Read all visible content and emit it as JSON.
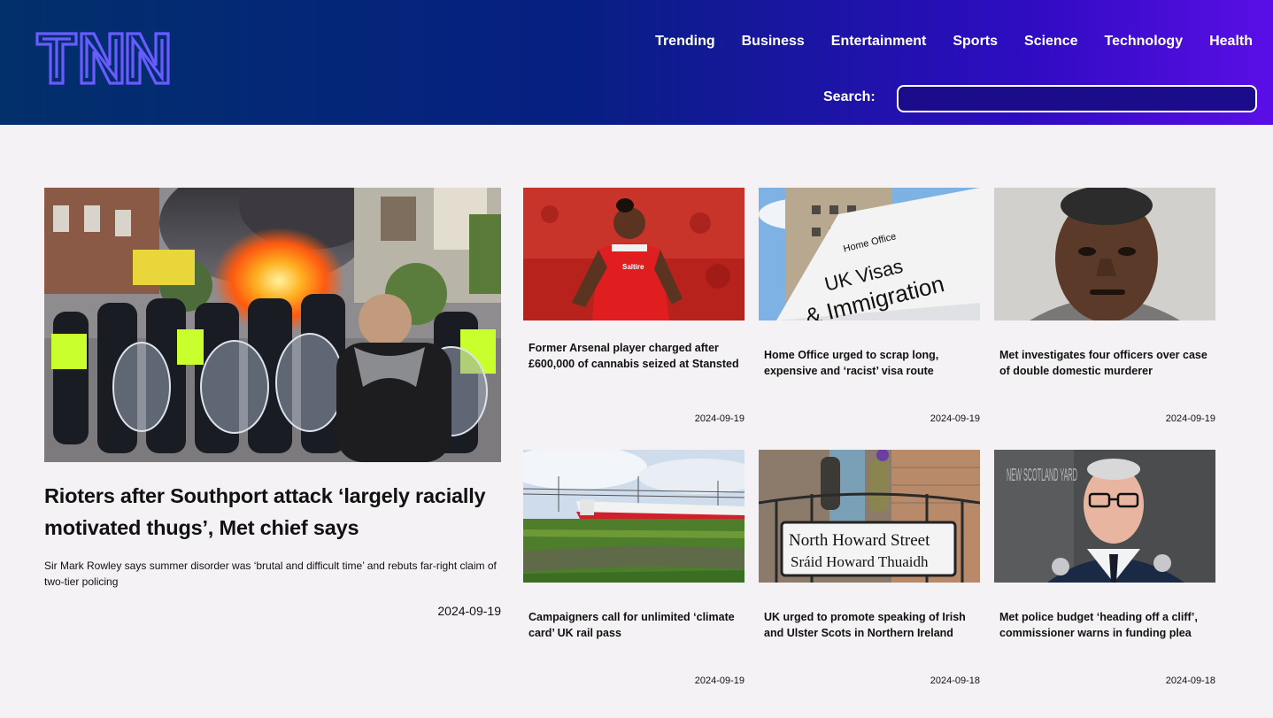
{
  "header": {
    "logo_text": "TNN",
    "nav": [
      "Trending",
      "Business",
      "Entertainment",
      "Sports",
      "Science",
      "Technology",
      "Health"
    ],
    "search_label": "Search:",
    "search_value": "",
    "search_placeholder": ""
  },
  "colors": {
    "accent_logo": "#6a5bff",
    "header_start": "#02306b",
    "header_end": "#5a0ee6"
  },
  "feature": {
    "title": "Rioters after Southport attack ‘largely racially motivated thugs’, Met chief says",
    "summary": "Sir Mark Rowley says summer disorder was ‘brutal and difficult time’ and rebuts far-right claim of two-tier policing",
    "date": "2024-09-19"
  },
  "cards": [
    {
      "title": "Former Arsenal player charged after £600,000 of cannabis seized at Stansted",
      "date": "2024-09-19"
    },
    {
      "title": "Home Office urged to scrap long, expensive and ‘racist’ visa route",
      "date": "2024-09-19"
    },
    {
      "title": "Met investigates four officers over case of double domestic murderer",
      "date": "2024-09-19"
    },
    {
      "title": "Campaigners call for unlimited ‘climate card’ UK rail pass",
      "date": "2024-09-19"
    },
    {
      "title": "UK urged to promote speaking of Irish and Ulster Scots in Northern Ireland",
      "date": "2024-09-18"
    },
    {
      "title": "Met police budget ‘heading off a cliff’, commissioner warns in funding plea",
      "date": "2024-09-18"
    }
  ],
  "image_text": {
    "visa_sign": [
      "Home Office",
      "UK Visas",
      "& Immigration"
    ],
    "street_sign": [
      "North Howard Street",
      "Sráid Howard Thuaidh"
    ],
    "scotland_yard": "NEW SCOTLAND YARD",
    "shirt": "Saltire"
  }
}
